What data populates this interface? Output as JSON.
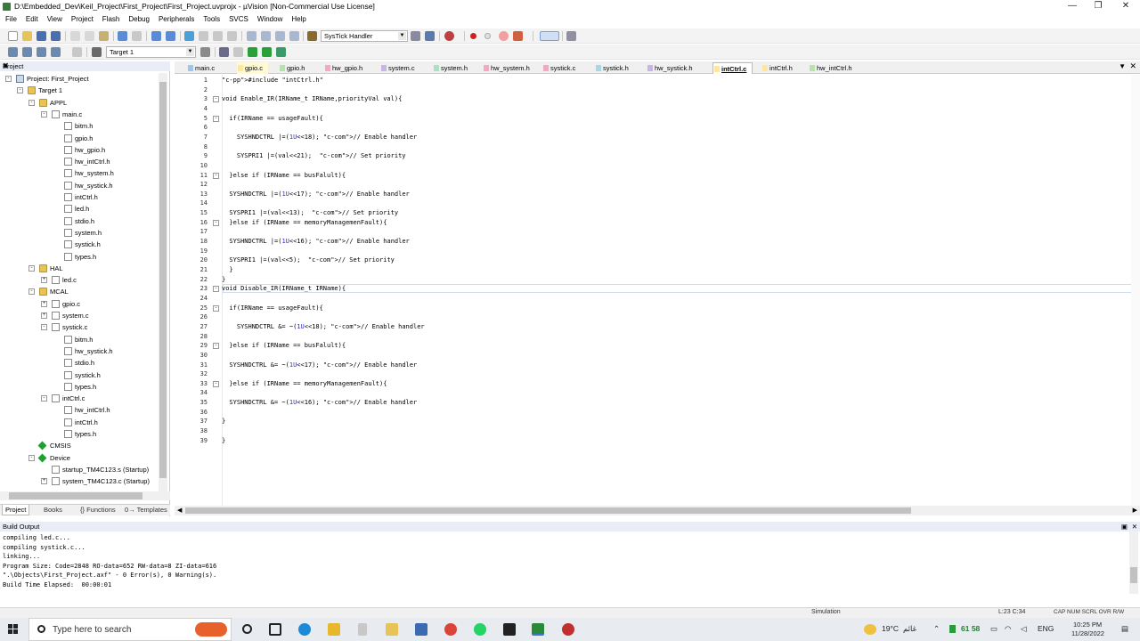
{
  "window": {
    "title": "D:\\Embedded_Dev\\Keil_Project\\First_Project\\First_Project.uvprojx - µVision  [Non-Commercial Use License]",
    "controls": [
      "—",
      "❐",
      "✕"
    ]
  },
  "menu": [
    "File",
    "Edit",
    "View",
    "Project",
    "Flash",
    "Debug",
    "Peripherals",
    "Tools",
    "SVCS",
    "Window",
    "Help"
  ],
  "toolbar": {
    "find_combo": "SysTick Handler",
    "target_combo": "Target 1"
  },
  "project_panel": {
    "title": "Project",
    "tree": [
      {
        "label": "Project: First_Project",
        "level": 0,
        "icon": "proj",
        "exp": "-"
      },
      {
        "label": "Target 1",
        "level": 1,
        "icon": "folder",
        "exp": "-"
      },
      {
        "label": "APPL",
        "level": 2,
        "icon": "folder",
        "exp": "-"
      },
      {
        "label": "main.c",
        "level": 3,
        "icon": "cfile",
        "exp": "-"
      },
      {
        "label": "bitm.h",
        "level": 4,
        "icon": "file"
      },
      {
        "label": "gpio.h",
        "level": 4,
        "icon": "file"
      },
      {
        "label": "hw_gpio.h",
        "level": 4,
        "icon": "file"
      },
      {
        "label": "hw_intCtrl.h",
        "level": 4,
        "icon": "file"
      },
      {
        "label": "hw_system.h",
        "level": 4,
        "icon": "file"
      },
      {
        "label": "hw_systick.h",
        "level": 4,
        "icon": "file"
      },
      {
        "label": "intCtrl.h",
        "level": 4,
        "icon": "file"
      },
      {
        "label": "led.h",
        "level": 4,
        "icon": "file"
      },
      {
        "label": "stdio.h",
        "level": 4,
        "icon": "file"
      },
      {
        "label": "system.h",
        "level": 4,
        "icon": "file"
      },
      {
        "label": "systick.h",
        "level": 4,
        "icon": "file"
      },
      {
        "label": "types.h",
        "level": 4,
        "icon": "file"
      },
      {
        "label": "HAL",
        "level": 2,
        "icon": "folder",
        "exp": "-"
      },
      {
        "label": "led.c",
        "level": 3,
        "icon": "cfile",
        "exp": "+"
      },
      {
        "label": "MCAL",
        "level": 2,
        "icon": "folder",
        "exp": "-"
      },
      {
        "label": "gpio.c",
        "level": 3,
        "icon": "cfile",
        "exp": "+"
      },
      {
        "label": "system.c",
        "level": 3,
        "icon": "cfile",
        "exp": "+"
      },
      {
        "label": "systick.c",
        "level": 3,
        "icon": "cfile",
        "exp": "-"
      },
      {
        "label": "bitm.h",
        "level": 4,
        "icon": "file"
      },
      {
        "label": "hw_systick.h",
        "level": 4,
        "icon": "file"
      },
      {
        "label": "stdio.h",
        "level": 4,
        "icon": "file"
      },
      {
        "label": "systick.h",
        "level": 4,
        "icon": "file"
      },
      {
        "label": "types.h",
        "level": 4,
        "icon": "file"
      },
      {
        "label": "intCtrl.c",
        "level": 3,
        "icon": "cfile",
        "exp": "-"
      },
      {
        "label": "hw_intCtrl.h",
        "level": 4,
        "icon": "file"
      },
      {
        "label": "intCtrl.h",
        "level": 4,
        "icon": "file"
      },
      {
        "label": "types.h",
        "level": 4,
        "icon": "file"
      },
      {
        "label": "CMSIS",
        "level": 2,
        "icon": "gem"
      },
      {
        "label": "Device",
        "level": 2,
        "icon": "gem",
        "exp": "-"
      },
      {
        "label": "startup_TM4C123.s (Startup)",
        "level": 3,
        "icon": "file"
      },
      {
        "label": "system_TM4C123.c (Startup)",
        "level": 3,
        "icon": "cfile",
        "exp": "+"
      }
    ],
    "tabs": [
      "Project",
      "Books",
      "{} Functions",
      "0→ Templates"
    ]
  },
  "editor": {
    "tabs": [
      {
        "label": "main.c",
        "color": "#9fc5e8"
      },
      {
        "label": "gpio.c",
        "color": "#ffe69a",
        "bg": "#fff9d6"
      },
      {
        "label": "gpio.h",
        "color": "#b6e3a8"
      },
      {
        "label": "hw_gpio.h",
        "color": "#f4a8c6"
      },
      {
        "label": "system.c",
        "color": "#c9b4e8"
      },
      {
        "label": "system.h",
        "color": "#a8e3c0"
      },
      {
        "label": "hw_system.h",
        "color": "#f4a8c6"
      },
      {
        "label": "systick.c",
        "color": "#f4a8c6"
      },
      {
        "label": "systick.h",
        "color": "#a8d8e3"
      },
      {
        "label": "hw_systick.h",
        "color": "#c9b4e8"
      },
      {
        "label": "intCtrl.c",
        "color": "#ffe69a",
        "active": true
      },
      {
        "label": "intCtrl.h",
        "color": "#ffe69a"
      },
      {
        "label": "hw_intCtrl.h",
        "color": "#b6e3a8"
      }
    ],
    "lines": [
      "#include \"intCtrl.h\"",
      "",
      "void Enable_IR(IRName_t IRName,priorityVal val){",
      "",
      "  if(IRName == usageFault){",
      "",
      "    SYSHNDCTRL |=(1U<<18); // Enable handler",
      "",
      "    SYSPRI1 |=(val<<21);  // Set priority",
      "",
      "  }else if (IRName == busFalult){",
      "",
      "  SYSHNDCTRL |=(1U<<17); // Enable handler",
      "",
      "  SYSPRI1 |=(val<<13);  // Set priority",
      "  }else if (IRName == memoryManagemenFault){",
      "",
      "  SYSHNDCTRL |=(1U<<16); // Enable handler",
      "",
      "  SYSPRI1 |=(val<<5);  // Set priority",
      "  }",
      "}",
      "void Disable_IR(IRName_t IRName){",
      "",
      "  if(IRName == usageFault){",
      "",
      "    SYSHNDCTRL &= ~(1U<<18); // Enable handler",
      "",
      "  }else if (IRName == busFalult){",
      "",
      "  SYSHNDCTRL &= ~(1U<<17); // Enable handler",
      "",
      "  }else if (IRName == memoryManagemenFault){",
      "",
      "  SYSHNDCTRL &= ~(1U<<16); // Enable handler",
      "",
      "}",
      "",
      "}"
    ],
    "folds": [
      3,
      5,
      11,
      16,
      23,
      25,
      29,
      33
    ]
  },
  "build_output": {
    "title": "Build Output",
    "lines": [
      "compiling led.c...",
      "compiling systick.c...",
      "linking...",
      "Program Size: Code=2848 RO-data=652 RW-data=8 ZI-data=616",
      "\".\\Objects\\First_Project.axf\" - 0 Error(s), 0 Warning(s).",
      "Build Time Elapsed:  00:00:01"
    ]
  },
  "status": {
    "mode": "Simulation",
    "cursor": "L:23 C:34",
    "keys": "CAP  NUM  SCRL  OVR  R/W"
  },
  "taskbar": {
    "search_placeholder": "Type here to search",
    "weather": "19°C",
    "weather_text": "غائم",
    "tray_nums": "61  58",
    "lang": "ENG",
    "time": "10:25 PM",
    "date": "11/28/2022"
  }
}
